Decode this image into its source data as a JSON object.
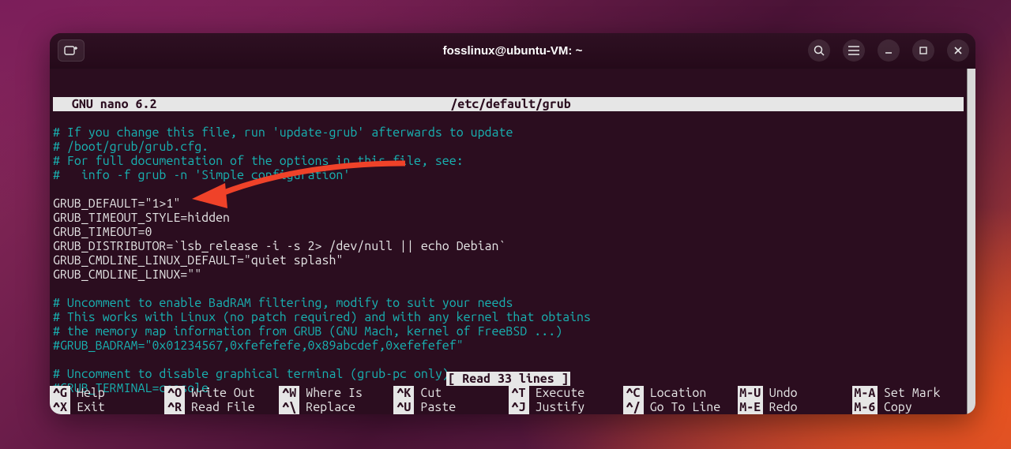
{
  "titlebar": {
    "title": "fosslinux@ubuntu-VM: ~"
  },
  "nano": {
    "app": "  GNU nano 6.2",
    "filename": "/etc/default/grub",
    "status": "[ Read 33 lines ]"
  },
  "file": {
    "c1": "# If you change this file, run 'update-grub' afterwards to update",
    "c2": "# /boot/grub/grub.cfg.",
    "c3": "# For full documentation of the options in this file, see:",
    "c4": "#   info -f grub -n 'Simple configuration'",
    "l1": "GRUB_DEFAULT=\"1>1\"",
    "l2": "GRUB_TIMEOUT_STYLE=hidden",
    "l3": "GRUB_TIMEOUT=0",
    "l4": "GRUB_DISTRIBUTOR=`lsb_release -i -s 2> /dev/null || echo Debian`",
    "l5": "GRUB_CMDLINE_LINUX_DEFAULT=\"quiet splash\"",
    "l6": "GRUB_CMDLINE_LINUX=\"\"",
    "c5": "# Uncomment to enable BadRAM filtering, modify to suit your needs",
    "c6": "# This works with Linux (no patch required) and with any kernel that obtains",
    "c7": "# the memory map information from GRUB (GNU Mach, kernel of FreeBSD ...)",
    "c8": "#GRUB_BADRAM=\"0x01234567,0xfefefefe,0x89abcdef,0xefefefef\"",
    "c9": "# Uncomment to disable graphical terminal (grub-pc only)",
    "c10": "#GRUB_TERMINAL=console"
  },
  "shortcuts": {
    "row1": [
      {
        "key": "^G",
        "label": "Help"
      },
      {
        "key": "^O",
        "label": "Write Out"
      },
      {
        "key": "^W",
        "label": "Where Is"
      },
      {
        "key": "^K",
        "label": "Cut"
      },
      {
        "key": "^T",
        "label": "Execute"
      },
      {
        "key": "^C",
        "label": "Location"
      },
      {
        "key": "M-U",
        "label": "Undo"
      },
      {
        "key": "M-A",
        "label": "Set Mark"
      }
    ],
    "row2": [
      {
        "key": "^X",
        "label": "Exit"
      },
      {
        "key": "^R",
        "label": "Read File"
      },
      {
        "key": "^\\",
        "label": "Replace"
      },
      {
        "key": "^U",
        "label": "Paste"
      },
      {
        "key": "^J",
        "label": "Justify"
      },
      {
        "key": "^/",
        "label": "Go To Line"
      },
      {
        "key": "M-E",
        "label": "Redo"
      },
      {
        "key": "M-6",
        "label": "Copy"
      }
    ]
  }
}
